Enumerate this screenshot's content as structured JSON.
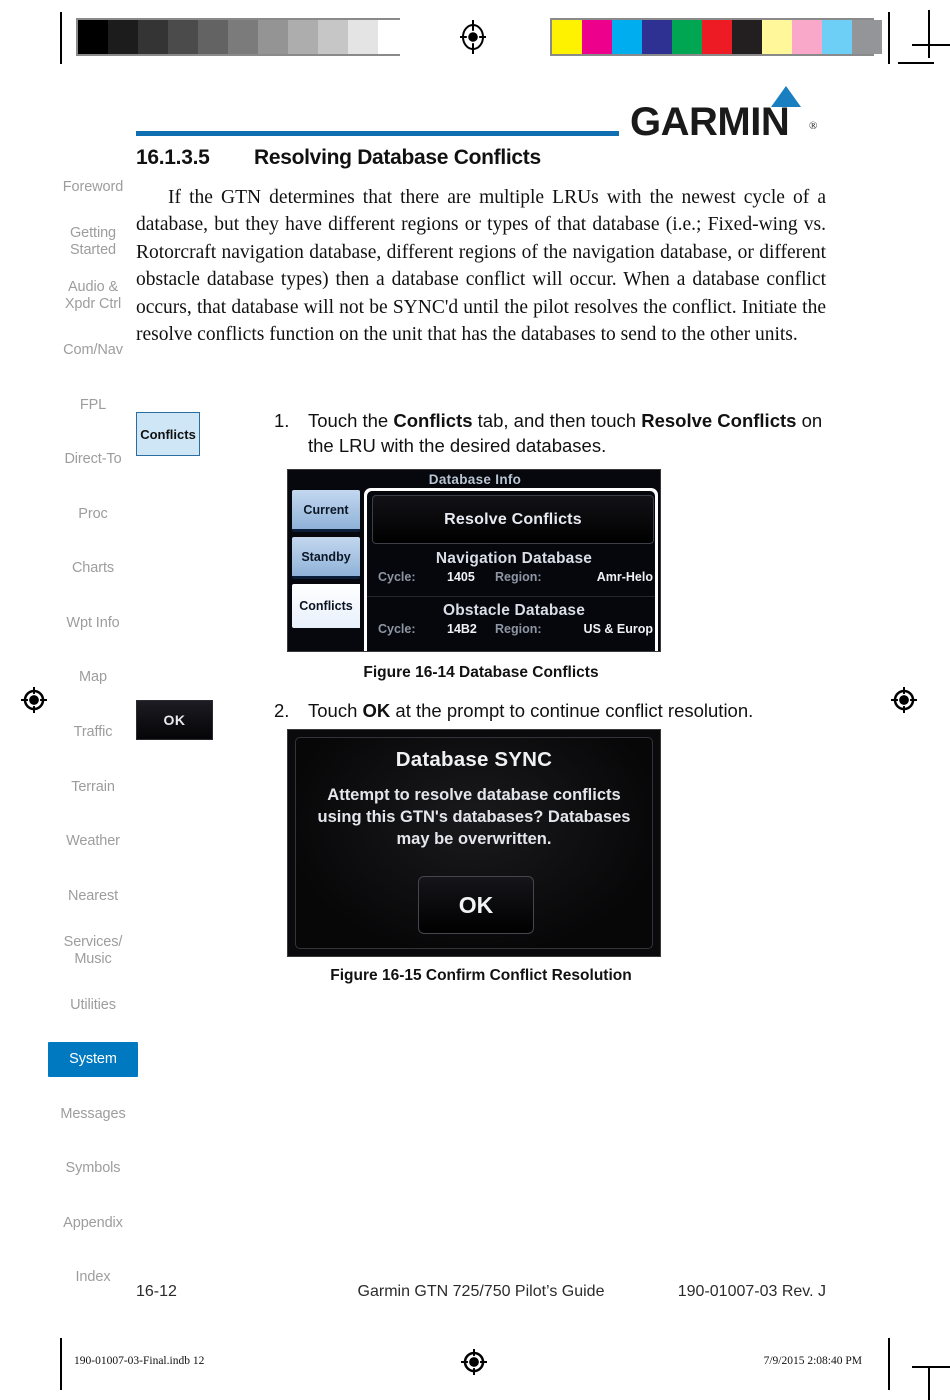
{
  "calibration": {
    "grayscale_swatches": [
      "#000000",
      "#1c1c1c",
      "#343434",
      "#4b4b4b",
      "#636363",
      "#7b7b7b",
      "#949494",
      "#adadad",
      "#c6c6c6",
      "#e4e4e4",
      "#ffffff"
    ],
    "color_swatches": [
      "#fff200",
      "#ec008c",
      "#00aeef",
      "#2e3192",
      "#00a651",
      "#ed1c24",
      "#231f20",
      "#fff79a",
      "#f9a8c9",
      "#6dcff6",
      "#939598"
    ]
  },
  "sidebar": {
    "items": [
      {
        "label": "Foreword",
        "active": false
      },
      {
        "label": "Getting\nStarted",
        "active": false
      },
      {
        "label": "Audio &\nXpdr Ctrl",
        "active": false
      },
      {
        "label": "Com/Nav",
        "active": false
      },
      {
        "label": "FPL",
        "active": false
      },
      {
        "label": "Direct-To",
        "active": false
      },
      {
        "label": "Proc",
        "active": false
      },
      {
        "label": "Charts",
        "active": false
      },
      {
        "label": "Wpt Info",
        "active": false
      },
      {
        "label": "Map",
        "active": false
      },
      {
        "label": "Traffic",
        "active": false
      },
      {
        "label": "Terrain",
        "active": false
      },
      {
        "label": "Weather",
        "active": false
      },
      {
        "label": "Nearest",
        "active": false
      },
      {
        "label": "Services/\nMusic",
        "active": false
      },
      {
        "label": "Utilities",
        "active": false
      },
      {
        "label": "System",
        "active": true
      },
      {
        "label": "Messages",
        "active": false
      },
      {
        "label": "Symbols",
        "active": false
      },
      {
        "label": "Appendix",
        "active": false
      },
      {
        "label": "Index",
        "active": false
      }
    ],
    "active_color": "#0079c1",
    "inactive_color": "#9d9d9d"
  },
  "brand": {
    "wordmark": "GARMIN",
    "registered_mark": "®",
    "triangle_color": "#1a7fc1",
    "rule_color": "#0f6fb0"
  },
  "section": {
    "number": "16.1.3.5",
    "title": "Resolving Database Conflicts",
    "paragraph": "If the GTN determines that there are multiple LRUs with the newest cycle of a database, but they have different regions or types of that database (i.e.; Fixed-wing vs. Rotorcraft navigation database, different regions of the navigation database, or different obstacle database types) then a database conflict will occur. When a database conflict occurs, that database will not be SYNC'd until the pilot resolves the conflict. Initiate the resolve conflicts function on the unit that has the databases to send to the other units."
  },
  "steps": [
    {
      "number": "1.",
      "text_parts": [
        "Touch the ",
        "Conflicts",
        " tab, and then touch ",
        "Resolve Conflicts",
        " on the LRU with the desired databases."
      ],
      "margin_key": "Conflicts"
    },
    {
      "number": "2.",
      "text_parts": [
        "Touch ",
        "OK",
        " at the prompt to continue conflict resolution."
      ],
      "margin_key": "OK"
    }
  ],
  "step1": {
    "num": "1.",
    "t1": "Touch the ",
    "b1": "Conflicts",
    "t2": " tab, and then touch ",
    "b2": "Resolve Conflicts",
    "t3": " on the LRU with the desired databases.",
    "key_label": "Conflicts"
  },
  "step2": {
    "num": "2.",
    "t1": "Touch ",
    "b1": "OK",
    "t2": " at the prompt to continue conflict resolution.",
    "key_label": "OK"
  },
  "figure1": {
    "screen_title": "Database Info",
    "tabs": [
      {
        "label": "Current",
        "selected": false
      },
      {
        "label": "Standby",
        "selected": false
      },
      {
        "label": "Conflicts",
        "selected": true
      }
    ],
    "resolve_button": "Resolve Conflicts",
    "databases": [
      {
        "name": "Navigation Database",
        "cycle_label": "Cycle:",
        "cycle_value": "1405",
        "region_label": "Region:",
        "region_value": "Amr-Helo"
      },
      {
        "name": "Obstacle Database",
        "cycle_label": "Cycle:",
        "cycle_value": "14B2",
        "region_label": "Region:",
        "region_value": "US & Europ"
      }
    ],
    "caption": "Figure 16-14  Database Conflicts"
  },
  "figure2": {
    "title": "Database SYNC",
    "message": "Attempt to resolve database conflicts using this GTN's databases? Databases may be overwritten.",
    "ok_button": "OK",
    "caption": "Figure 16-15  Confirm Conflict Resolution"
  },
  "footer": {
    "page_number": "16-12",
    "document_title": "Garmin GTN 725/750 Pilot’s Guide",
    "part_number": "190-01007-03  Rev. J"
  },
  "print_info": {
    "file": "190-01007-03-Final.indb   12",
    "timestamp": "7/9/2015   2:08:40 PM"
  }
}
